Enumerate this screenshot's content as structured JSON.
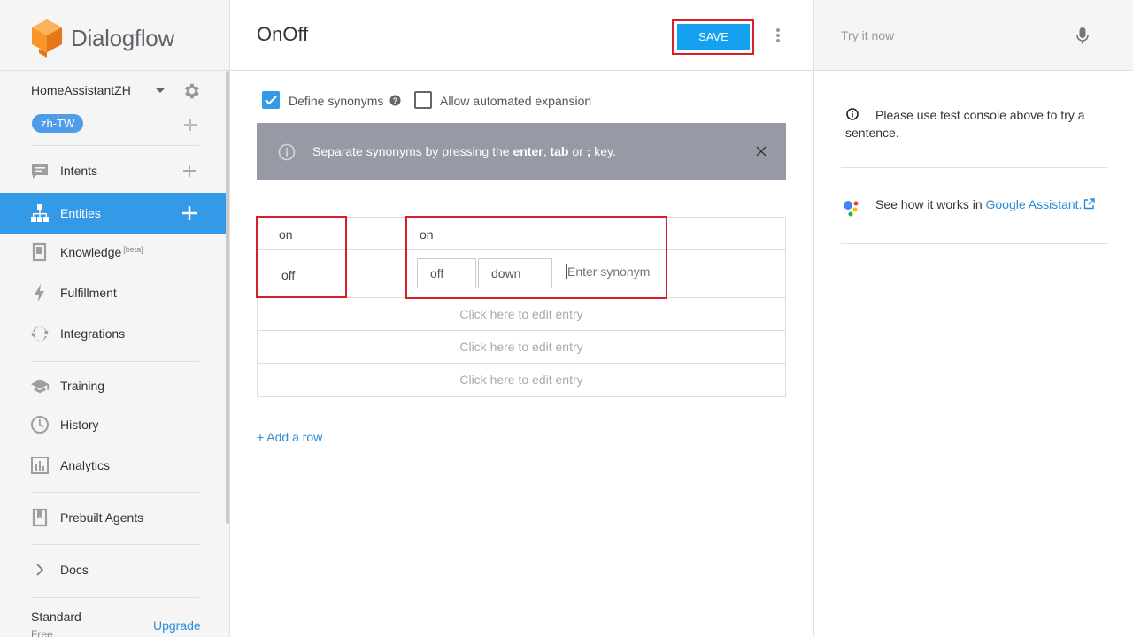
{
  "brand": {
    "name": "Dialogflow"
  },
  "agent": {
    "name": "HomeAssistantZH",
    "language": "zh-TW"
  },
  "nav": {
    "intents": "Intents",
    "entities": "Entities",
    "knowledge": "Knowledge",
    "knowledge_badge": "[beta]",
    "fulfillment": "Fulfillment",
    "integrations": "Integrations",
    "training": "Training",
    "history": "History",
    "analytics": "Analytics",
    "prebuilt": "Prebuilt Agents",
    "docs": "Docs"
  },
  "plan": {
    "name": "Standard",
    "tier": "Free",
    "upgrade": "Upgrade"
  },
  "entity": {
    "title": "OnOff",
    "save_label": "SAVE",
    "define_synonyms": "Define synonyms",
    "define_synonyms_checked": true,
    "auto_expansion": "Allow automated expansion",
    "auto_expansion_checked": false,
    "info": {
      "prefix": "Separate synonyms by pressing the ",
      "enter": "enter",
      "comma": ", ",
      "tab": "tab",
      "or": " or ",
      "semicolon": ";",
      "suffix": " key."
    },
    "rows": [
      {
        "value": "on",
        "synonyms": [
          "on"
        ]
      },
      {
        "value": "off",
        "synonyms": [
          "off",
          "down"
        ]
      }
    ],
    "synonym_placeholder": "Enter synonym",
    "empty_row_text": "Click here to edit entry",
    "add_row": "+ Add a row"
  },
  "console": {
    "try_placeholder": "Try it now",
    "hint": "Please use test console above to try a sentence.",
    "ga_prefix": "See how it works in ",
    "ga_link": "Google Assistant."
  },
  "colors": {
    "accent": "#349ae8",
    "save": "#13a1f0",
    "highlight": "#d81e2a",
    "info_bar": "#979aa5",
    "link": "#2a8bd8"
  }
}
